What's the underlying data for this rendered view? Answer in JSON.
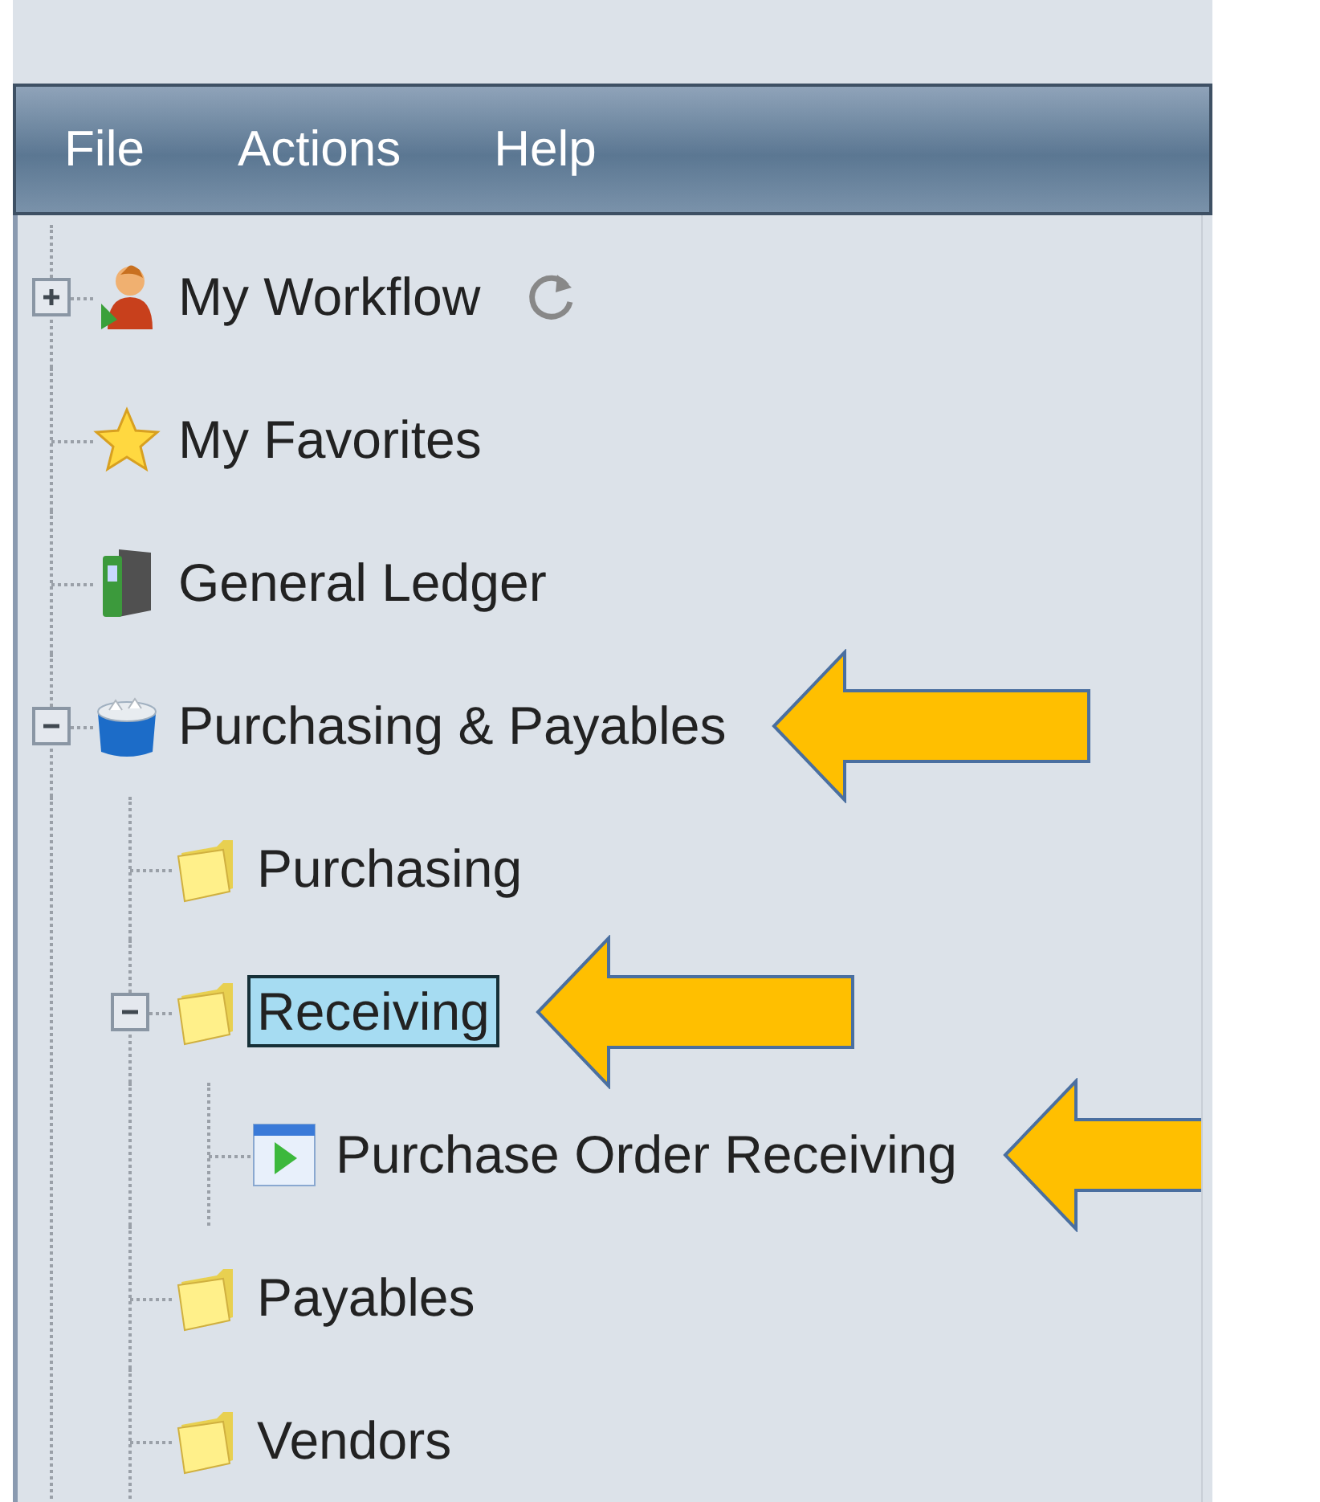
{
  "menu": [
    {
      "label": "File"
    },
    {
      "label": "Actions"
    },
    {
      "label": "Help"
    }
  ],
  "tree": [
    {
      "label": "My Workflow",
      "kind": "person",
      "expanded": false,
      "refresh": true,
      "selected": false,
      "arrow": false
    },
    {
      "label": "My Favorites",
      "kind": "star",
      "selected": false,
      "arrow": false
    },
    {
      "label": "General Ledger",
      "kind": "binder",
      "selected": false,
      "arrow": false
    },
    {
      "label": "Purchasing & Payables",
      "kind": "bucket",
      "expanded": true,
      "selected": false,
      "arrow": true,
      "children": [
        {
          "label": "Purchasing",
          "kind": "folder",
          "selected": false,
          "arrow": false
        },
        {
          "label": "Receiving",
          "kind": "folder",
          "expanded": true,
          "selected": true,
          "arrow": true,
          "children": [
            {
              "label": "Purchase Order Receiving",
              "kind": "form",
              "selected": false,
              "arrow": true
            }
          ]
        },
        {
          "label": "Payables",
          "kind": "folder",
          "selected": false,
          "arrow": false
        },
        {
          "label": "Vendors",
          "kind": "folder",
          "selected": false,
          "arrow": false
        }
      ]
    }
  ]
}
